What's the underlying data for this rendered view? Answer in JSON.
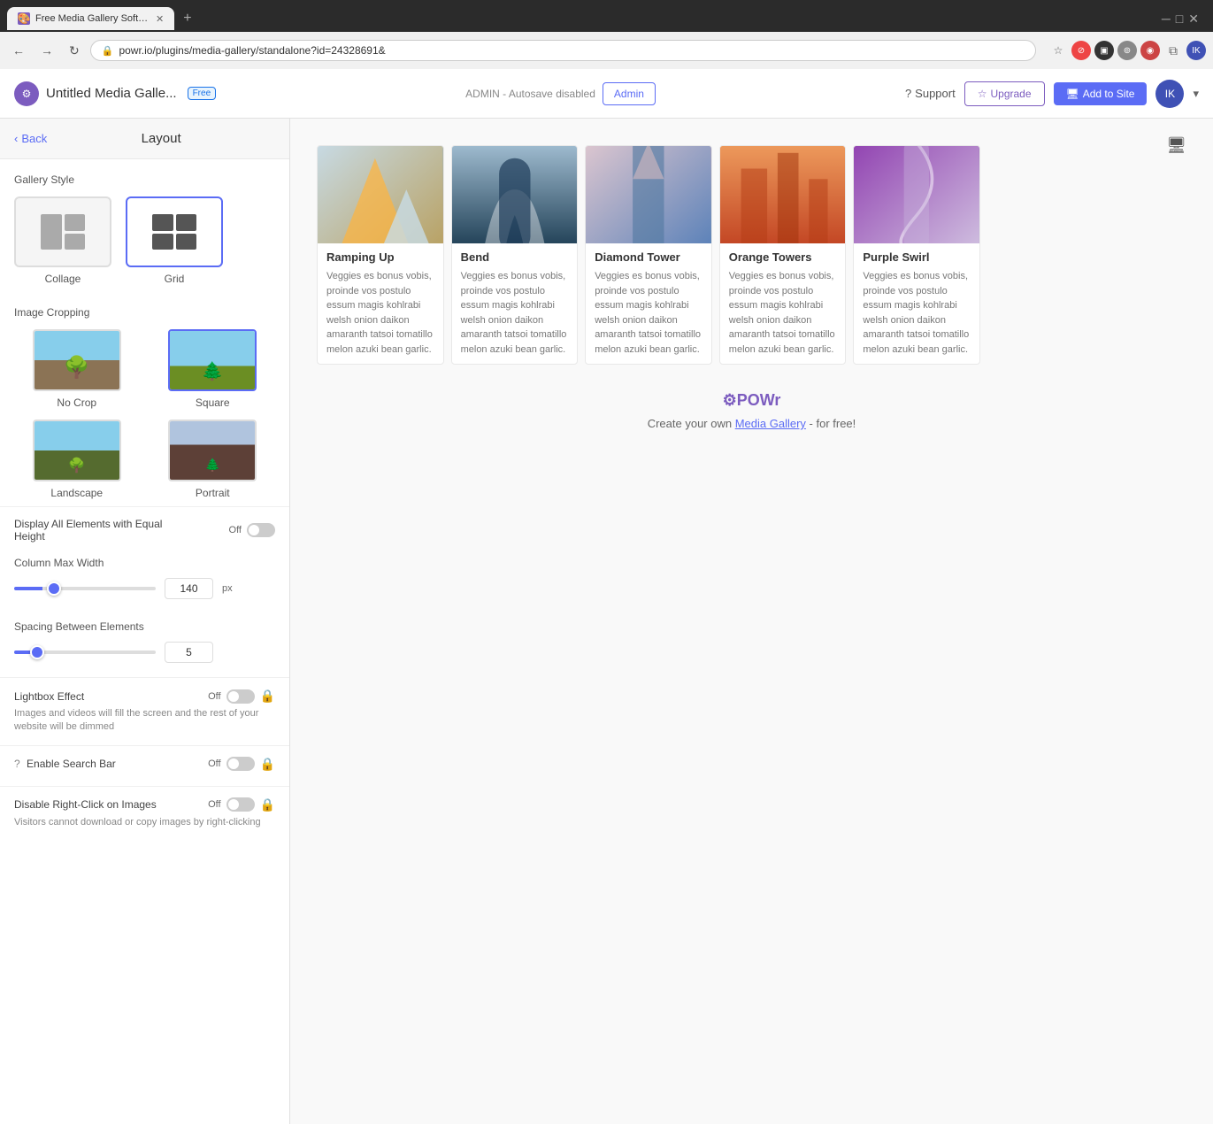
{
  "browser": {
    "tab_title": "Free Media Gallery Software App...",
    "tab_favicon": "🎨",
    "address": "powr.io/plugins/media-gallery/standalone?id=24328691&",
    "new_tab_label": "+"
  },
  "header": {
    "logo_text": "IK",
    "app_title": "Untitled Media Galle...",
    "free_badge": "Free",
    "admin_status": "ADMIN - Autosave disabled",
    "admin_btn": "Admin",
    "support_label": "Support",
    "upgrade_label": "Upgrade",
    "add_to_site_label": "Add to Site",
    "avatar_initials": "IK"
  },
  "sidebar": {
    "back_label": "Back",
    "title": "Layout",
    "gallery_style_label": "Gallery Style",
    "style_options": [
      {
        "id": "collage",
        "label": "Collage",
        "selected": false
      },
      {
        "id": "grid",
        "label": "Grid",
        "selected": true
      }
    ],
    "image_cropping_label": "Image Cropping",
    "crop_options": [
      {
        "id": "no-crop",
        "label": "No Crop",
        "selected": false
      },
      {
        "id": "square",
        "label": "Square",
        "selected": true
      },
      {
        "id": "landscape",
        "label": "Landscape",
        "selected": false
      },
      {
        "id": "portrait",
        "label": "Portrait",
        "selected": false
      }
    ],
    "equal_height_label": "Display All Elements with Equal Height",
    "equal_height_state": "Off",
    "column_max_width_label": "Column Max Width",
    "column_max_width_value": "140",
    "column_max_width_unit": "px",
    "spacing_label": "Spacing Between Elements",
    "spacing_value": "5",
    "lightbox_label": "Lightbox Effect",
    "lightbox_desc": "Images and videos will fill the screen and the rest of your website will be dimmed",
    "lightbox_state": "Off",
    "search_bar_label": "Enable Search Bar",
    "search_bar_state": "Off",
    "right_click_label": "Disable Right-Click on Images",
    "right_click_desc": "Visitors cannot download or copy images by right-clicking",
    "right_click_state": "Off"
  },
  "gallery": {
    "cards": [
      {
        "title": "Ramping Up",
        "img_type": "ramp",
        "text": "Veggies es bonus vobis, proinde vos postulo essum magis kohlrabi welsh onion daikon amaranth tatsoi tomatillo melon azuki bean garlic."
      },
      {
        "title": "Bend",
        "img_type": "bend",
        "text": "Veggies es bonus vobis, proinde vos postulo essum magis kohlrabi welsh onion daikon amaranth tatsoi tomatillo melon azuki bean garlic."
      },
      {
        "title": "Diamond Tower",
        "img_type": "diamond",
        "text": "Veggies es bonus vobis, proinde vos postulo essum magis kohlrabi welsh onion daikon amaranth tatsoi tomatillo melon azuki bean garlic."
      },
      {
        "title": "Orange Towers",
        "img_type": "orange",
        "text": "Veggies es bonus vobis, proinde vos postulo essum magis kohlrabi welsh onion daikon amaranth tatsoi tomatillo melon azuki bean garlic."
      },
      {
        "title": "Purple Swirl",
        "img_type": "purple",
        "text": "Veggies es bonus vobis, proinde vos postulo essum magis kohlrabi welsh onion daikon amaranth tatsoi tomatillo melon azuki bean garlic."
      }
    ]
  },
  "footer": {
    "logo": "⚙POWr",
    "text": "Create your own ",
    "link_text": "Media Gallery",
    "suffix": " - for free!"
  }
}
